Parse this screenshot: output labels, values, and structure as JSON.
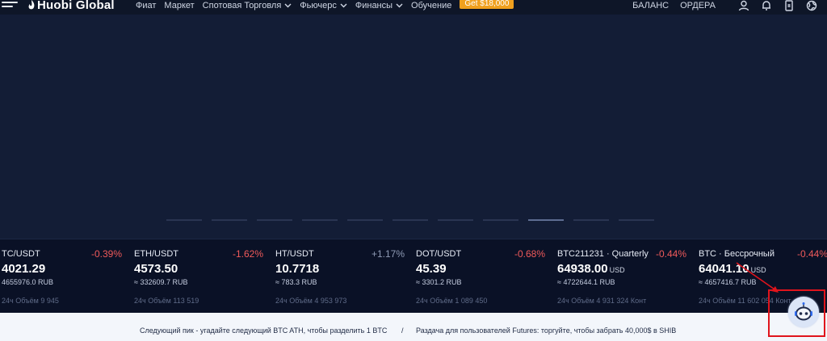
{
  "header": {
    "logo": "Huobi Global",
    "nav": [
      {
        "label": "Фиат"
      },
      {
        "label": "Маркет"
      },
      {
        "label": "Спотовая Торговля"
      },
      {
        "label": "Фьючерс"
      },
      {
        "label": "Финансы"
      },
      {
        "label": "Обучение"
      }
    ],
    "promo": "Get $18,000",
    "balance": "БАЛАНС",
    "orders": "ОРДЕРА"
  },
  "tickers": [
    {
      "pair": "TC/USDT",
      "change": "-0.39%",
      "price": "4021.29",
      "unit": "",
      "rub": "4655976.0 RUB",
      "volume": "24ч Объём 9 945"
    },
    {
      "pair": "ETH/USDT",
      "change": "-1.62%",
      "price": "4573.50",
      "unit": "",
      "rub": "≈ 332609.7 RUB",
      "volume": "24ч Объём 113 519"
    },
    {
      "pair": "HT/USDT",
      "change": "+1.17%",
      "price": "10.7718",
      "unit": "",
      "rub": "≈ 783.3 RUB",
      "volume": "24ч Объём 4 953 973"
    },
    {
      "pair": "DOT/USDT",
      "change": "-0.68%",
      "price": "45.39",
      "unit": "",
      "rub": "≈ 3301.2 RUB",
      "volume": "24ч Объём 1 089 450"
    },
    {
      "pair": "BTC211231 · Quarterly",
      "change": "-0.44%",
      "price": "64938.00",
      "unit": "USD",
      "rub": "≈ 4722644.1 RUB",
      "volume": "24ч Объём 4 931 324 Конт"
    },
    {
      "pair": "BTC · Бессрочный",
      "change": "-0.44%",
      "price": "64041.10",
      "unit": "USD",
      "rub": "≈ 4657416.7 RUB",
      "volume": "24ч Объём 11 602 054 Конт"
    }
  ],
  "news": {
    "item1": "Следующий пик - угадайте следующий BTC ATH, чтобы разделить 1 BTC",
    "separator": "/",
    "item2": "Раздача для пользователей Futures: торгуйте, чтобы забрать 40,000$ в SHIB"
  },
  "carousel": {
    "slides": 9,
    "active": 8
  },
  "colors": {
    "negative": "#f05a5a",
    "promo": "#f0a01e",
    "highlight": "#e0141c"
  }
}
